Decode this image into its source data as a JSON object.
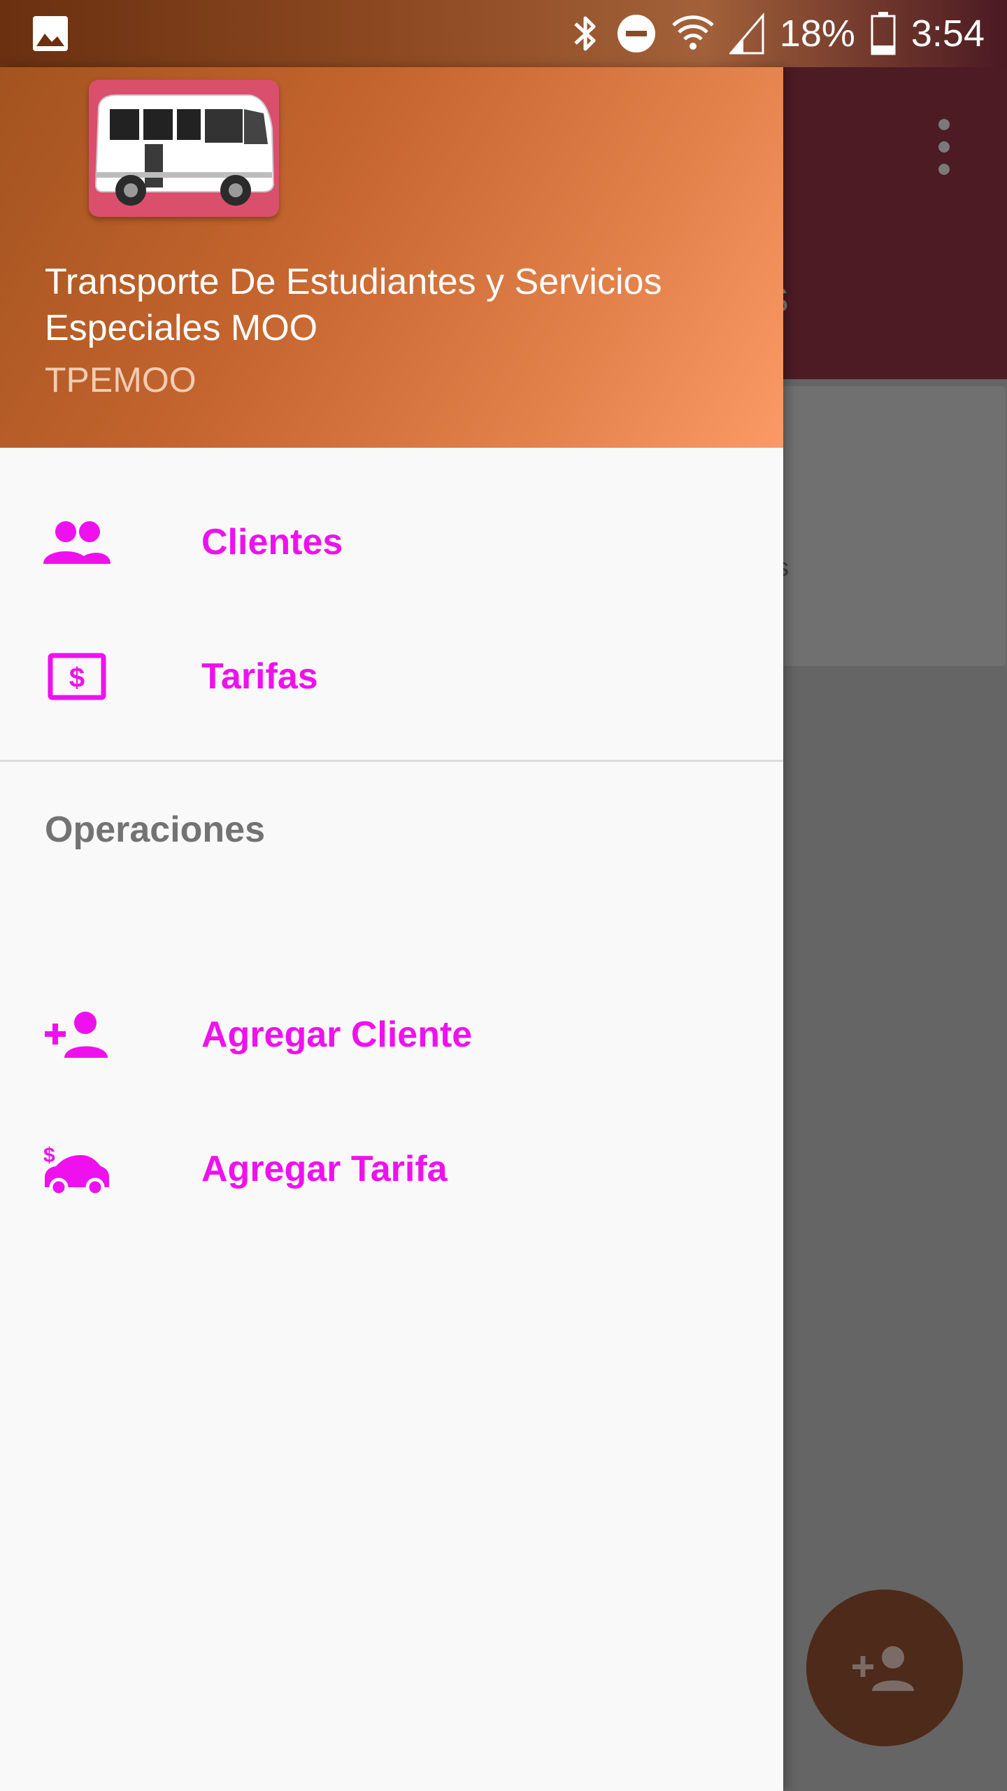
{
  "status_bar": {
    "battery": "18%",
    "time": "3:54",
    "icons": [
      "gallery-icon",
      "bluetooth-icon",
      "do-not-disturb-icon",
      "wifi-icon",
      "signal-icon",
      "battery-icon"
    ]
  },
  "background_app": {
    "tab_fragment": "AS",
    "card_text_fragment": "os",
    "fab_icon": "add-person-icon"
  },
  "drawer": {
    "header": {
      "title": "Transporte De Estudiantes y Servicios Especiales MOO",
      "subtitle": "TPEMOO",
      "logo": "bus-logo"
    },
    "items": [
      {
        "label": "Clientes",
        "icon": "people-icon"
      },
      {
        "label": "Tarifas",
        "icon": "money-icon"
      }
    ],
    "section": {
      "title": "Operaciones",
      "items": [
        {
          "label": "Agregar Cliente",
          "icon": "add-person-icon"
        },
        {
          "label": "Agregar Tarifa",
          "icon": "car-money-icon"
        }
      ]
    }
  },
  "colors": {
    "accent": "#ee11ee",
    "header_start": "#a3531f",
    "header_end": "#fb9a66",
    "toolbar": "#4d1b24",
    "fab": "#4e2a1a"
  }
}
